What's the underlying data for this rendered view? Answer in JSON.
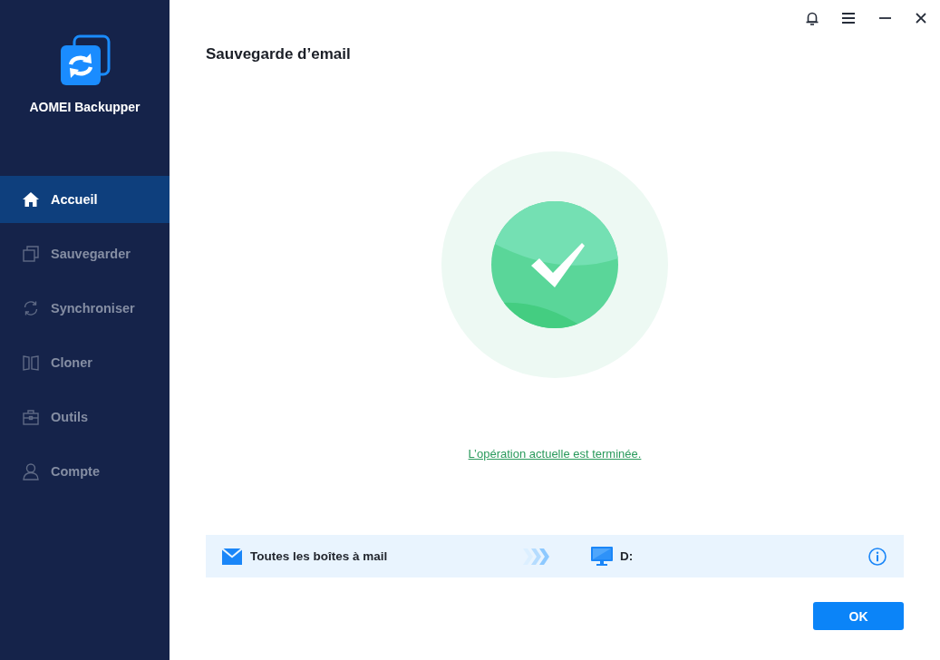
{
  "sidebar": {
    "app_name": "AOMEI Backupper",
    "items": [
      {
        "kind": "home",
        "label": "Accueil",
        "selected": true
      },
      {
        "kind": "backup",
        "label": "Sauvegarder",
        "selected": false
      },
      {
        "kind": "sync",
        "label": "Synchroniser",
        "selected": false
      },
      {
        "kind": "clone",
        "label": "Cloner",
        "selected": false
      },
      {
        "kind": "tools",
        "label": "Outils",
        "selected": false
      },
      {
        "kind": "account",
        "label": "Compte",
        "selected": false
      }
    ]
  },
  "page_title": "Sauvegarde d’email",
  "status_link": "L’opération actuelle est terminée.",
  "task": {
    "source": "Toutes les boîtes à mail",
    "destination": "D:"
  },
  "ok_button": "OK"
}
